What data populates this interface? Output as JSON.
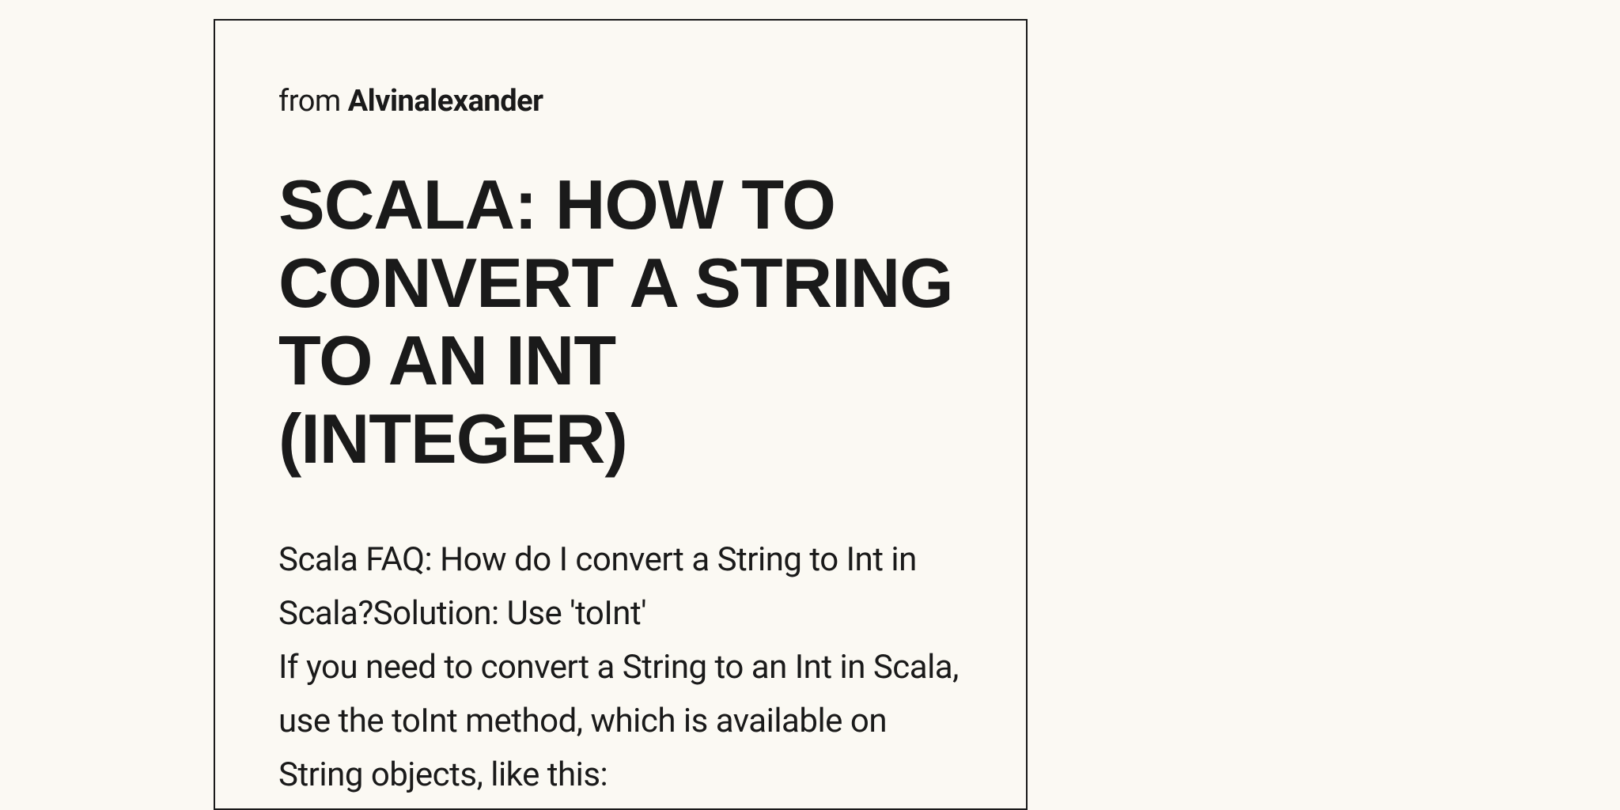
{
  "source": {
    "from_label": "from",
    "author": "Alvinalexander"
  },
  "title": "SCALA: HOW TO CONVERT A STRING TO AN INT (INTEGER)",
  "body": {
    "paragraph1": "Scala FAQ: How do I convert a String to Int in Scala?Solution: Use 'toInt'",
    "paragraph2": "If you need to convert a String to an Int in Scala, use the toInt method, which is available on String objects, like this:"
  }
}
